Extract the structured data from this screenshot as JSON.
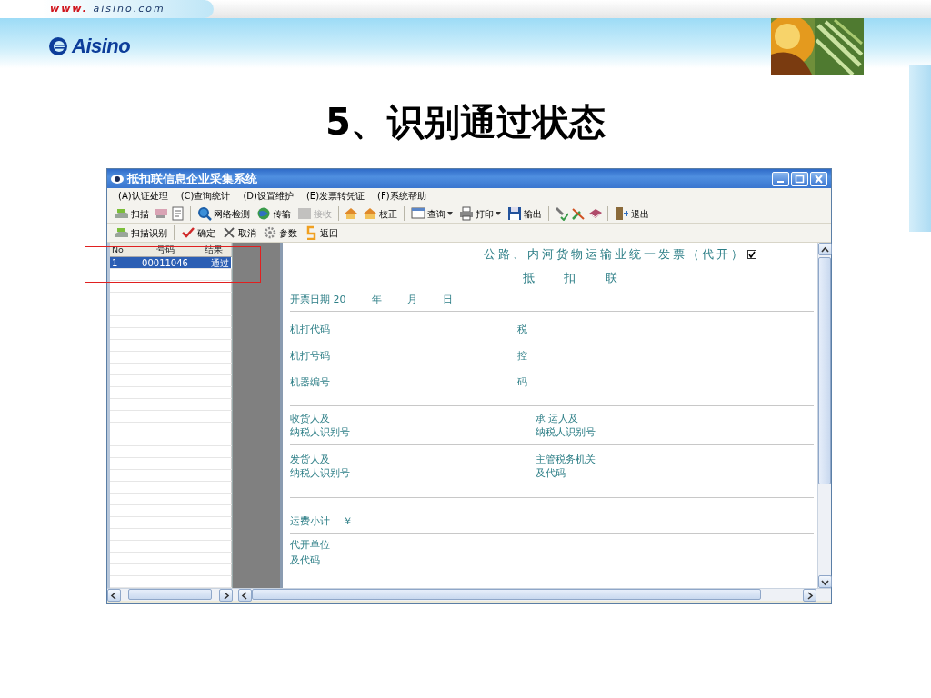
{
  "slide": {
    "url_prefix": "www.",
    "url_domain": "aisino.com",
    "logo": "Aisino",
    "title": "5、识别通过状态"
  },
  "window": {
    "title": "抵扣联信息企业采集系统",
    "menu": [
      "(A)认证处理",
      "(C)查询统计",
      "(D)设置维护",
      "(E)发票转凭证",
      "(F)系统帮助"
    ],
    "toolbar": [
      {
        "kind": "button",
        "label": "扫描",
        "disabled": false,
        "dropdown": false
      },
      {
        "kind": "button",
        "disabled": false,
        "dropdown": false
      },
      {
        "kind": "button",
        "disabled": false,
        "dropdown": false
      },
      {
        "kind": "separator"
      },
      {
        "kind": "button",
        "label": "网络检测",
        "disabled": false,
        "dropdown": false
      },
      {
        "kind": "button",
        "label": "传输",
        "disabled": false,
        "dropdown": false
      },
      {
        "kind": "button",
        "label": "接收",
        "disabled": true,
        "dropdown": false
      },
      {
        "kind": "separator"
      },
      {
        "kind": "button",
        "disabled": false,
        "dropdown": false
      },
      {
        "kind": "button",
        "label": "校正",
        "disabled": false,
        "dropdown": false
      },
      {
        "kind": "separator"
      },
      {
        "kind": "button",
        "label": "查询",
        "disabled": false,
        "dropdown": true
      },
      {
        "kind": "button",
        "label": "打印",
        "disabled": false,
        "dropdown": true
      },
      {
        "kind": "button",
        "label": "输出",
        "disabled": false,
        "dropdown": false
      },
      {
        "kind": "separator"
      },
      {
        "kind": "button",
        "disabled": false,
        "dropdown": false
      },
      {
        "kind": "button",
        "disabled": false,
        "dropdown": false
      },
      {
        "kind": "button",
        "disabled": false,
        "dropdown": false
      },
      {
        "kind": "separator"
      },
      {
        "kind": "button",
        "label": "退出",
        "disabled": false,
        "dropdown": false
      }
    ],
    "toolbar2": [
      {
        "kind": "button",
        "label": "扫描识别",
        "disabled": false,
        "dropdown": false
      },
      {
        "kind": "separator"
      },
      {
        "kind": "button",
        "label": "确定",
        "disabled": false,
        "dropdown": false
      },
      {
        "kind": "button",
        "label": "取消",
        "disabled": false,
        "dropdown": false
      },
      {
        "kind": "button",
        "label": "参数",
        "disabled": false,
        "dropdown": false
      },
      {
        "kind": "button",
        "label": "返回",
        "disabled": false,
        "dropdown": false
      }
    ],
    "list": {
      "columns": [
        "No",
        "号码",
        "结果"
      ],
      "rows": [
        {
          "cells": [
            "1",
            "00011046",
            "通过"
          ],
          "selected": true
        }
      ]
    },
    "form": {
      "title": "公路、内河货物运输业统一发票（代开）",
      "checked": true,
      "subtitle": "抵 扣 联",
      "date": {
        "label": "开票日期 20",
        "year": "年",
        "month": "月",
        "day": "日"
      },
      "codes": [
        {
          "label": "机打代码",
          "side": "税"
        },
        {
          "label": "机打号码",
          "side": "控"
        },
        {
          "label": "机器编号",
          "side": "码"
        }
      ],
      "parties": [
        {
          "left": [
            "收货人及",
            "纳税人识别号"
          ],
          "right": [
            "承 运人及",
            "纳税人识别号"
          ]
        },
        {
          "left": [
            "发货人及",
            "纳税人识别号"
          ],
          "right": [
            "主管税务机关",
            "及代码"
          ]
        }
      ],
      "subtotal": {
        "label": "运费小计",
        "symbol": "￥"
      },
      "issuer": [
        "代开单位",
        "及代码"
      ]
    }
  }
}
